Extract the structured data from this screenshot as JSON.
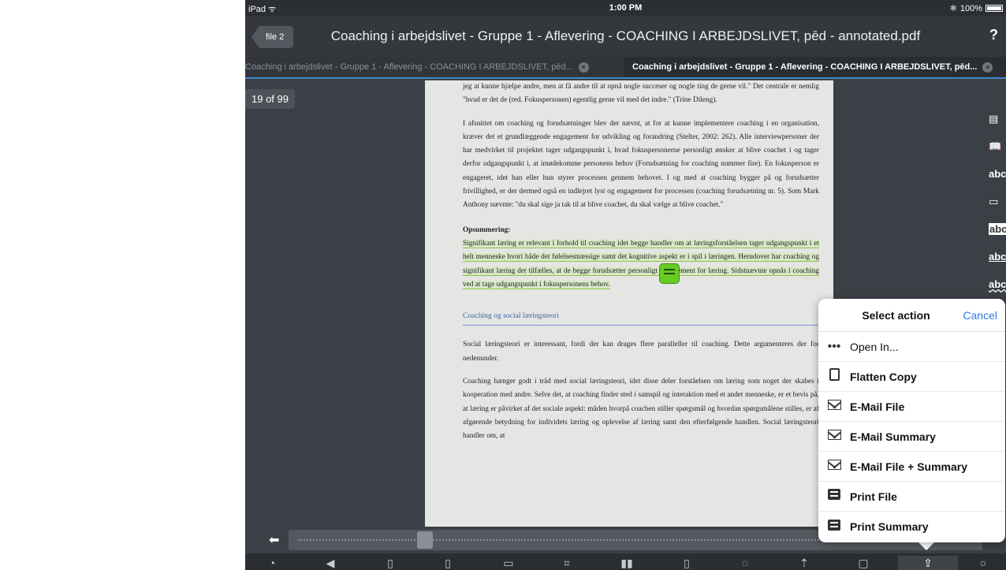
{
  "status_bar": {
    "device": "iPad ᯤ",
    "time": "1:00 PM",
    "bluetooth": "✱",
    "battery": "100%"
  },
  "nav": {
    "back_label": "file 2",
    "title": "Coaching i arbejdslivet - Gruppe 1 - Aflevering - COACHING I ARBEJDSLIVET, pēd - annotated.pdf",
    "help": "?"
  },
  "tabs": [
    {
      "label": "Coaching i arbejdslivet - Gruppe 1 - Aflevering - COACHING I ARBEJDSLIVET, pēd...",
      "close": "×"
    },
    {
      "label": "Coaching i arbejdslivet - Gruppe 1 - Aflevering - COACHING I ARBEJDSLIVET, pēd...",
      "close": "×"
    }
  ],
  "page_indicator": "19 of 99",
  "document": {
    "p1": "jeg at kunne hjælpe andre, men at få andre til at opnå nogle succeser og nogle ting de gerne vil.\" Det centrale er nemlig \"hvad er det de (red. Fokuspersonen) egentlig gerne vil med det indre.\" (Trine Dileng).",
    "p2": "I afsnittet om coaching og forudsætninger blev der nævnt, at for at kunne implementere coaching i en organisation, kræver det et grundlæggende engagement for udvikling og forandring (Stelter, 2002: 262). Alle interviewpersoner der har medvirket til projektet tager udgangspunkt i, hvad fokuspersonerne personligt ønsker at blive coachet i og tager derfor udgangspunkt i, at imødekomme personens behov (Forudsætning for coaching nummer fire). En fokusperson er engageret, idet han eller hun styrer processen gennem behovet. I og med at coaching bygger på og forudsætter frivillighed, er der dermed også en indlejret lyst og engagement for processen (coaching forudsætning nr. 5). Som Mark Anthony nævnte: \"du skal sige ja tak til at blive coachet, du skal vælge at blive coachet.\"",
    "summary_heading": "Opsummering:",
    "summary": "Signifikant læring er relevant i forhold til coaching idet begge handler om at læringsforståelsen tager udgangspunkt i et helt menneske hvori både det følelsesmæssige samt det kognitive aspekt er i spil i læringen. Herudover har coaching og signifikant læring det tilfælles, at de begge forudsætter personligt engagement for læring. Sidstnævnte opnås i coaching ved at tage udgangspunkt i fokuspersonens behov.",
    "section_heading": "Coaching og social læringsteori",
    "p3": "Social læringsteori er interessant, fordi der kan drages flere paralleller til coaching. Dette argumenteres der for nedenunder.",
    "p4": "Coaching hænger godt i tråd med social læringsteori, idet disse deler forståelsen om læring som noget der skabes i kooperation med andre. Selve det, at coaching finder sted i samspil og interaktion med et andet menneske, er et bevis på, at læring er påvirket af det sociale aspekt: måden hvorpå coachen stiller spørgsmål og hvordan spørgsmålene stilles, er af afgørende betydning for individets læring og oplevelse af læring samt den efterfølgende handlen. Social læringsteori handler om, at"
  },
  "tools": [
    "▤",
    "📖",
    "abc",
    "▭",
    "abc",
    "abc",
    "abc"
  ],
  "scrubber": {
    "back_icon": "arrow-left-icon",
    "position_fraction": 0.19
  },
  "toolbar": {
    "icons": [
      "search-icon",
      "play-back-icon",
      "add-page-icon",
      "add-page-alt-icon",
      "note-icon",
      "crop-icon",
      "book-icon",
      "export-doc-icon",
      "comment-icon",
      "upload-icon",
      "blank-icon",
      "share-icon",
      "search2-icon"
    ]
  },
  "action_sheet": {
    "title": "Select action",
    "cancel": "Cancel",
    "items": [
      {
        "label": "Open In...",
        "icon": "ellipsis-icon"
      },
      {
        "label": "Flatten Copy",
        "icon": "document-icon"
      },
      {
        "label": "E-Mail File",
        "icon": "mail-icon"
      },
      {
        "label": "E-Mail Summary",
        "icon": "mail-icon"
      },
      {
        "label": "E-Mail File + Summary",
        "icon": "mail-icon"
      },
      {
        "label": "Print File",
        "icon": "printer-icon"
      },
      {
        "label": "Print Summary",
        "icon": "printer-icon"
      }
    ]
  }
}
